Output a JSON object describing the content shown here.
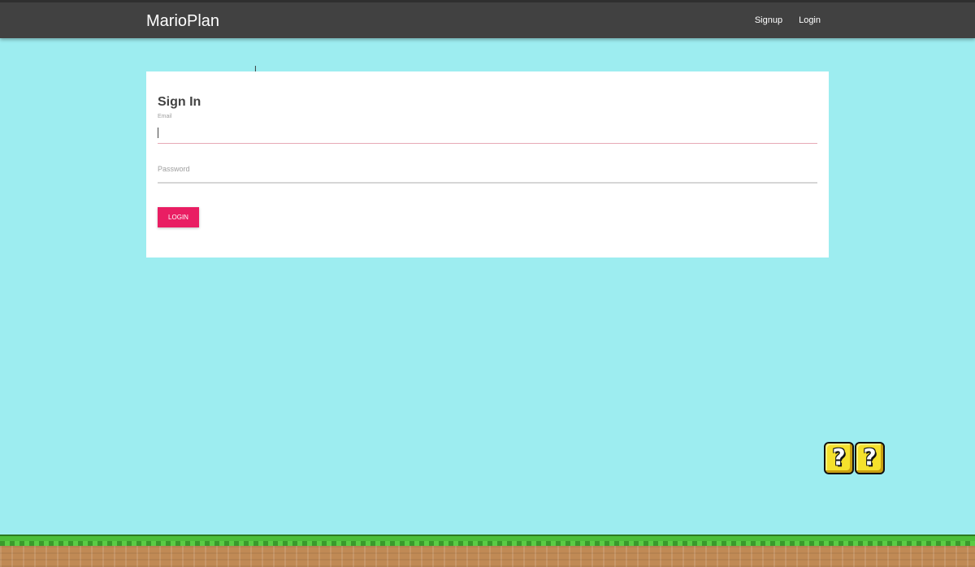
{
  "navbar": {
    "brand": "MarioPlan",
    "links": [
      "Signup",
      "Login"
    ]
  },
  "signin": {
    "title": "Sign In",
    "email": {
      "label": "Email",
      "value": ""
    },
    "password": {
      "label": "Password",
      "value": ""
    },
    "submit_label": "LOGIN"
  },
  "decor": {
    "question_block_glyph": "?",
    "colors": {
      "sky": "#9dedf0",
      "navbar": "#414141",
      "button": "#e91e63",
      "grass": "#4cbe3a",
      "dirt": "#c08a55"
    }
  }
}
